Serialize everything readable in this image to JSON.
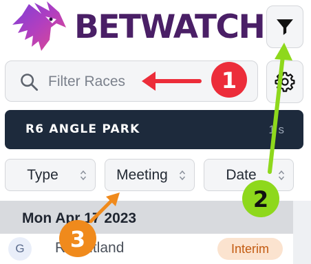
{
  "header": {
    "brand": "BETWATCH",
    "logo_icon": "eagle-logo-icon",
    "filter_icon": "funnel-icon"
  },
  "search": {
    "placeholder": "Filter Races",
    "value": "",
    "icon": "search-icon"
  },
  "settings": {
    "icon": "gear-icon"
  },
  "race_bar": {
    "name": "R6 ANGLE PARK",
    "time": "1 s"
  },
  "filters": {
    "type_label": "Type",
    "meeting_label": "Meeting",
    "date_label": "Date"
  },
  "day": {
    "label": "Mon Apr 17 2023"
  },
  "row": {
    "avatar_letter": "G",
    "name": "R Maitland",
    "status": "Interim"
  },
  "annotations": {
    "badge_1": "1",
    "badge_2": "2",
    "badge_3": "3"
  },
  "colors": {
    "brand": "#4a1f66",
    "race_bar": "#1d2a3c",
    "badge_red": "#ec2d3a",
    "arrow_green": "#8ed81c",
    "badge_orange": "#f08a1c",
    "interim_bg": "#fbe3cf"
  }
}
